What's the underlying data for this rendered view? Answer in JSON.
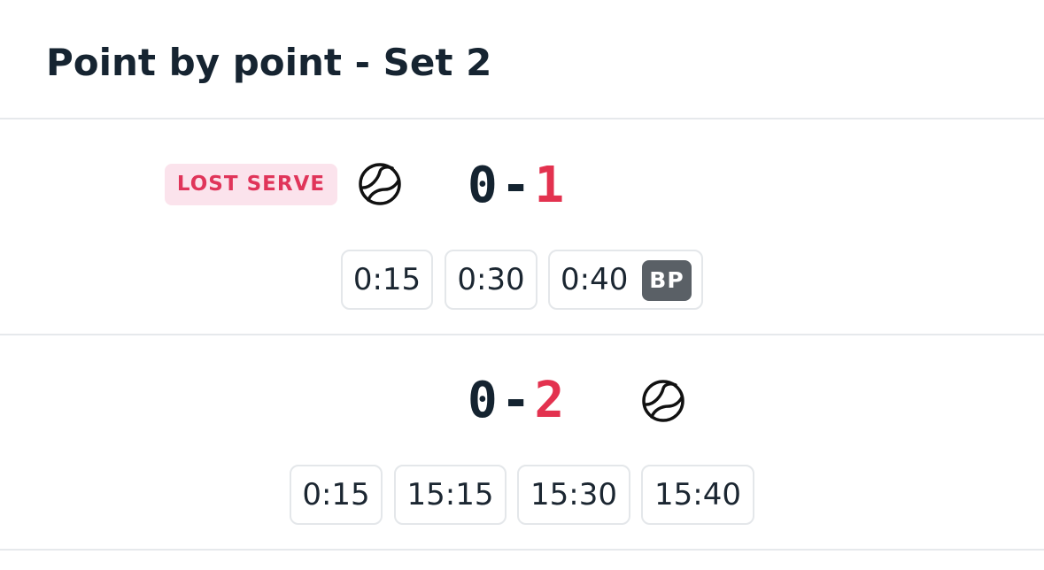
{
  "header": {
    "title": "Point by point - Set 2"
  },
  "games": [
    {
      "badge": "LOST SERVE",
      "serve_icon": "tennis-ball-icon",
      "score_home": "0",
      "score_sep": "-",
      "score_away": "1",
      "points": [
        "0:15",
        "0:30",
        "0:40"
      ],
      "point_tag": "BP"
    },
    {
      "serve_icon": "tennis-ball-icon",
      "score_home": "0",
      "score_sep": "-",
      "score_away": "2",
      "points": [
        "0:15",
        "15:15",
        "15:30",
        "15:40"
      ]
    }
  ],
  "colors": {
    "text": "#162431",
    "accent_red": "#e3324f",
    "badge_bg": "#fbe3ec",
    "bp_bg": "#5a6066",
    "divider": "#e6e9ec"
  }
}
